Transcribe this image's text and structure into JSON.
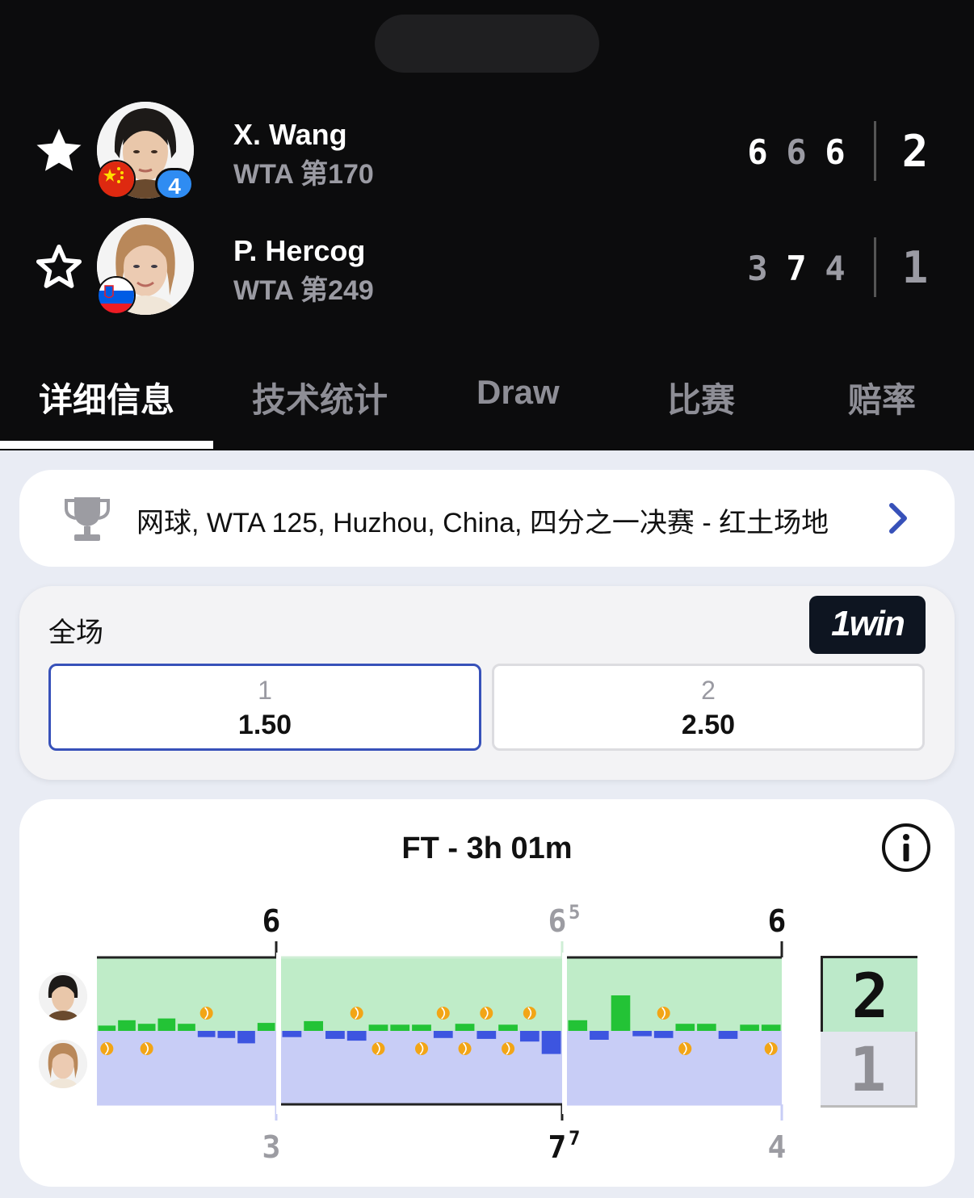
{
  "players": [
    {
      "name": "X. Wang",
      "rank": "WTA 第170",
      "favorite": true,
      "seed": "4",
      "sets": [
        "6",
        "6",
        "6"
      ],
      "sets_won": "2"
    },
    {
      "name": "P. Hercog",
      "rank": "WTA 第249",
      "favorite": false,
      "seed": "",
      "sets": [
        "3",
        "7",
        "4"
      ],
      "sets_won": "1"
    }
  ],
  "tabs": [
    {
      "label": "详细信息",
      "active": true
    },
    {
      "label": "技术统计",
      "active": false
    },
    {
      "label": "Draw",
      "active": false
    },
    {
      "label": "比赛",
      "active": false
    },
    {
      "label": "赔率",
      "active": false
    }
  ],
  "tournament": {
    "text": "网球, WTA 125, Huzhou, China, 四分之一决赛 - 红土场地",
    "icon": "trophy-icon"
  },
  "odds": {
    "label": "全场",
    "brand": "1win",
    "options": [
      {
        "label": "1",
        "value": "1.50",
        "selected": true
      },
      {
        "label": "2",
        "value": "2.50",
        "selected": false
      }
    ]
  },
  "momentum": {
    "title": "FT - 3h 01m",
    "top_scores": [
      {
        "main": "6",
        "sup": ""
      },
      {
        "main": "6",
        "sup": "5"
      },
      {
        "main": "6",
        "sup": ""
      }
    ],
    "bottom_scores": [
      {
        "main": "3",
        "sup": ""
      },
      {
        "main": "7",
        "sup": "7"
      },
      {
        "main": "4",
        "sup": ""
      }
    ],
    "sets_won": {
      "top": "2",
      "bottom": "1"
    },
    "colors": {
      "top": "#23c336",
      "bottom": "#3d55e0",
      "top_fill": "#bfecc8",
      "bottom_fill": "#c8cdf6",
      "break": "#f2a516"
    },
    "sets": [
      {
        "games": [
          0.3,
          0.6,
          0.4,
          0.7,
          0.4,
          -0.35,
          -0.4,
          -0.7,
          0.45
        ],
        "breaks_top": [
          5
        ],
        "breaks_bottom": [
          0,
          2
        ]
      },
      {
        "games": [
          -0.35,
          0.55,
          -0.45,
          -0.55,
          0.35,
          0.35,
          0.35,
          -0.4,
          0.4,
          -0.45,
          0.35,
          -0.6,
          -1.3
        ],
        "breaks_top": [
          3,
          7,
          9,
          11
        ],
        "breaks_bottom": [
          4,
          6,
          8,
          10
        ]
      },
      {
        "games": [
          0.6,
          -0.5,
          2.0,
          -0.3,
          -0.4,
          0.4,
          0.4,
          -0.45,
          0.35,
          0.35
        ],
        "breaks_top": [
          4
        ],
        "breaks_bottom": [
          5,
          9
        ]
      }
    ]
  }
}
